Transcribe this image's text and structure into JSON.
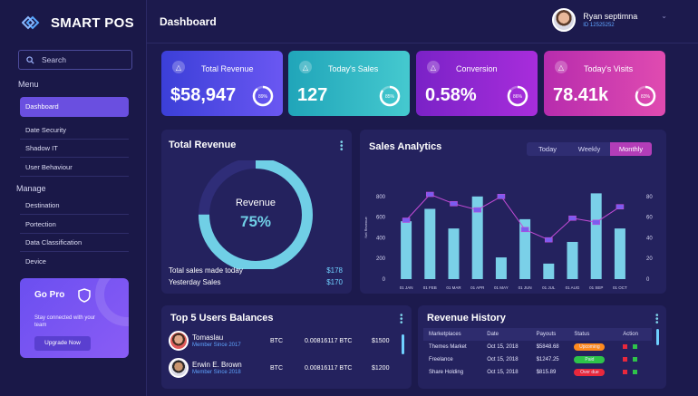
{
  "brand": {
    "name": "SMART POS"
  },
  "search": {
    "label": "Search"
  },
  "menu": {
    "title": "Menu",
    "items": [
      {
        "label": "Dashboard"
      },
      {
        "label": "Date Security"
      },
      {
        "label": "Shadow IT"
      },
      {
        "label": "User Behaviour"
      }
    ]
  },
  "manage": {
    "title": "Manage",
    "items": [
      {
        "label": "Destination"
      },
      {
        "label": "Portection"
      },
      {
        "label": "Data Classification"
      },
      {
        "label": "Device"
      }
    ]
  },
  "gopro": {
    "title": "Go Pro",
    "text": "Stay connected with your team",
    "button": "Upgrade Now"
  },
  "header": {
    "title": "Dashboard"
  },
  "user": {
    "name": "Ryan septimna",
    "id": "ID 12525252"
  },
  "stats": [
    {
      "label": "Total Revenue",
      "value": "$58,947",
      "pct": "89%",
      "level": 0.89,
      "from": "#3b3fd8",
      "to": "#6a57f2"
    },
    {
      "label": "Today's Sales",
      "value": "127",
      "pct": "85%",
      "level": 0.85,
      "from": "#20a5b9",
      "to": "#45c9cf"
    },
    {
      "label": "Conversion",
      "value": "0.58%",
      "pct": "86%",
      "level": 0.86,
      "from": "#7a22c7",
      "to": "#a82ddb"
    },
    {
      "label": "Today's Visits",
      "value": "78.41k",
      "pct": "83%",
      "level": 0.83,
      "from": "#b72cae",
      "to": "#e04bb0"
    }
  ],
  "total_revenue": {
    "title": "Total Revenue",
    "donut_label": "Revenue",
    "donut_value": "75%",
    "donut_level": 0.75,
    "rows": [
      {
        "label": "Total sales made today",
        "value": "$178"
      },
      {
        "label": "Yesterday Sales",
        "value": "$170"
      }
    ]
  },
  "analytics": {
    "title": "Sales Analytics",
    "tabs": [
      "Today",
      "Weekly",
      "Monthly"
    ],
    "active_tab": "Monthly"
  },
  "chart_data": {
    "type": "bar",
    "categories": [
      "01 JAN",
      "01 FEB",
      "01 MAR",
      "01 APR",
      "01 MAY",
      "01 JUN",
      "01 JUL",
      "01 AUG",
      "01 SEP",
      "01 OCT"
    ],
    "series": [
      {
        "values": [
          560,
          680,
          490,
          800,
          210,
          580,
          150,
          360,
          830,
          490
        ]
      },
      {
        "values": [
          57,
          82,
          73,
          67,
          80,
          48,
          38,
          59,
          55,
          70
        ]
      }
    ],
    "ylabel": "Net Revenue",
    "ylim": [
      0,
      1000
    ],
    "y_ticks": [
      "0",
      "200",
      "400",
      "600",
      "800"
    ],
    "y2lim": [
      0,
      100
    ],
    "y2_ticks": [
      "0",
      "20",
      "40",
      "60",
      "80"
    ],
    "bar_color": "#7ad0e8",
    "line_color": "#c24bd6"
  },
  "balances": {
    "title": "Top 5 Users Balances",
    "rows": [
      {
        "name": "Tomaslau",
        "since": "Member Since 2017",
        "coin": "BTC",
        "amount": "0.00816117 BTC",
        "usd": "$1500"
      },
      {
        "name": "Erwin E. Brown",
        "since": "Member Since 2018",
        "coin": "BTC",
        "amount": "0.00816117 BTC",
        "usd": "$1200"
      }
    ]
  },
  "revenue_history": {
    "title": "Revenue History",
    "columns": [
      "Marketplaces",
      "Date",
      "Payouts",
      "Status",
      "Action"
    ],
    "rows": [
      {
        "market": "Themes Market",
        "date": "Oct 15, 2018",
        "payout": "$5848.68",
        "status": "Upcoming",
        "color": "#ff8a1e"
      },
      {
        "market": "Freelance",
        "date": "Oct 15, 2018",
        "payout": "$1247.25",
        "status": "Paid",
        "color": "#2ec34a"
      },
      {
        "market": "Share Holding",
        "date": "Oct 15, 2018",
        "payout": "$815.89",
        "status": "Over due",
        "color": "#e8283c"
      }
    ]
  }
}
